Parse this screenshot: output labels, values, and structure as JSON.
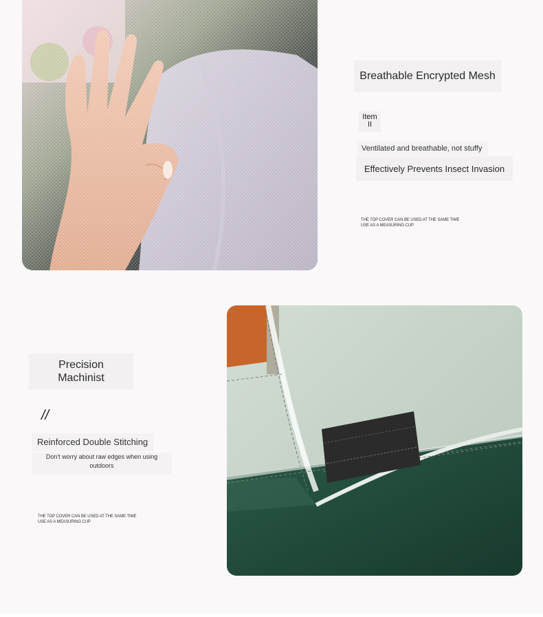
{
  "section1": {
    "title": "Breathable Encrypted Mesh",
    "item_label": "Item",
    "item_number": "II",
    "subtitle": "Ventilated and breathable, not stuffy",
    "tagline": "Effectively Prevents Insect Invasion",
    "fine_print": [
      "THE TOP COVER CAN BE USED AT THE SAME TIME",
      "USE AS A MEASURING CUP"
    ]
  },
  "section2": {
    "title_line1": "Precision",
    "title_line2": "Machinist",
    "number_mark": "//",
    "subtitle": "Reinforced Double Stitching",
    "description_line1": "Don't worry about raw edges when using",
    "description_line2": "outdoors",
    "fine_print": [
      "THE TOP COVER CAN BE USED AT THE SAME TIME",
      "USE AS A MEASURING CUP"
    ]
  },
  "colors": {
    "background": "#faf8f8",
    "tent_light": "#c9d6cc",
    "tent_dark": "#1f4a3a",
    "accent_orange": "#c8652a",
    "velcro": "#2b2b2b"
  }
}
